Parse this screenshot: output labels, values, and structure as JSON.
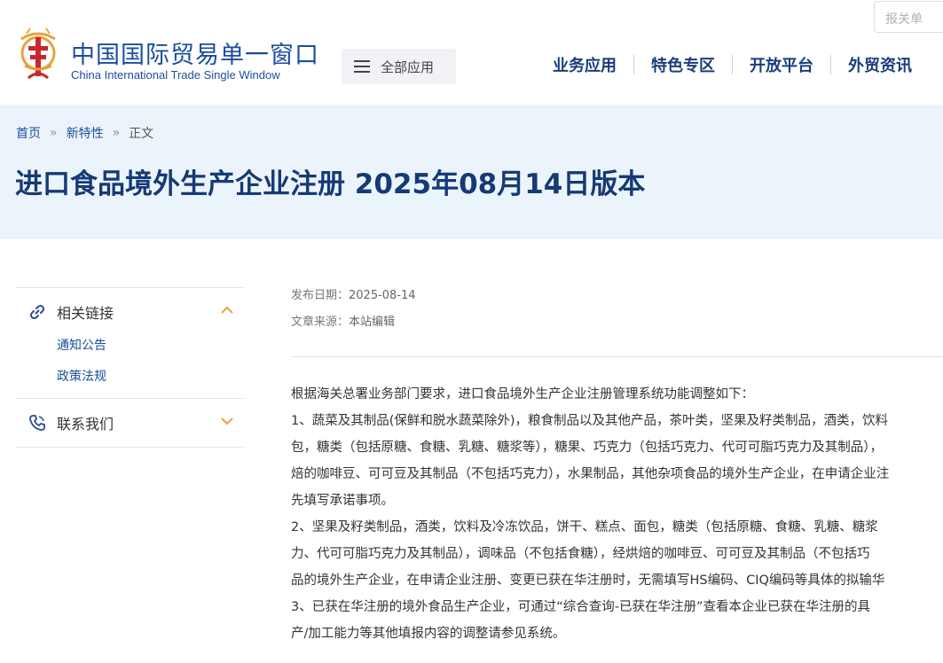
{
  "header": {
    "brand_cn": "中国国际贸易单一窗口",
    "brand_en": "China International Trade Single Window",
    "all_apps_label": "全部应用",
    "nav": [
      "业务应用",
      "特色专区",
      "开放平台",
      "外贸资讯"
    ],
    "report_placeholder": "报关单"
  },
  "breadcrumb": {
    "home": "首页",
    "section": "新特性",
    "current": "正文",
    "separator": "»"
  },
  "article": {
    "title": "进口食品境外生产企业注册 2025年08月14日版本",
    "publish_label": "发布日期：",
    "publish_date": "2025-08-14",
    "source_label": "文章来源：",
    "source": "本站编辑",
    "lines": [
      "根据海关总署业务部门要求，进口食品境外生产企业注册管理系统功能调整如下：",
      "1、蔬菜及其制品(保鲜和脱水蔬菜除外)，粮食制品以及其他产品，茶叶类，坚果及籽类制品，酒类，饮料",
      "包，糖类（包括原糖、食糖、乳糖、糖浆等），糖果、巧克力（包括巧克力、代可可脂巧克力及其制品），",
      "焙的咖啡豆、可可豆及其制品（不包括巧克力），水果制品，其他杂项食品的境外生产企业，在申请企业注",
      "先填写承诺事项。",
      "2、坚果及籽类制品，酒类，饮料及冷冻饮品，饼干、糕点、面包，糖类（包括原糖、食糖、乳糖、糖浆",
      "力、代可可脂巧克力及其制品），调味品（不包括食糖），经烘焙的咖啡豆、可可豆及其制品（不包括巧",
      "品的境外生产企业，在申请企业注册、变更已获在华注册时，无需填写HS编码、CIQ编码等具体的拟输华",
      "3、已获在华注册的境外食品生产企业，可通过“综合查询-已获在华注册”查看本企业已获在华注册的具",
      "产/加工能力等其他填报内容的调整请参见系统。"
    ]
  },
  "sidebar": {
    "related_links": {
      "label": "相关链接",
      "items": [
        "通知公告",
        "政策法规"
      ]
    },
    "contact": {
      "label": "联系我们"
    }
  },
  "colors": {
    "brand_blue": "#1a4e9c",
    "title_blue": "#163a75",
    "banner_bg": "#ebf4fb",
    "accent_orange": "#e8a23a"
  },
  "icons": [
    "logo-emblem-icon",
    "menu-icon",
    "link-icon",
    "chevron-up-icon",
    "phone-icon",
    "chevron-down-icon"
  ]
}
